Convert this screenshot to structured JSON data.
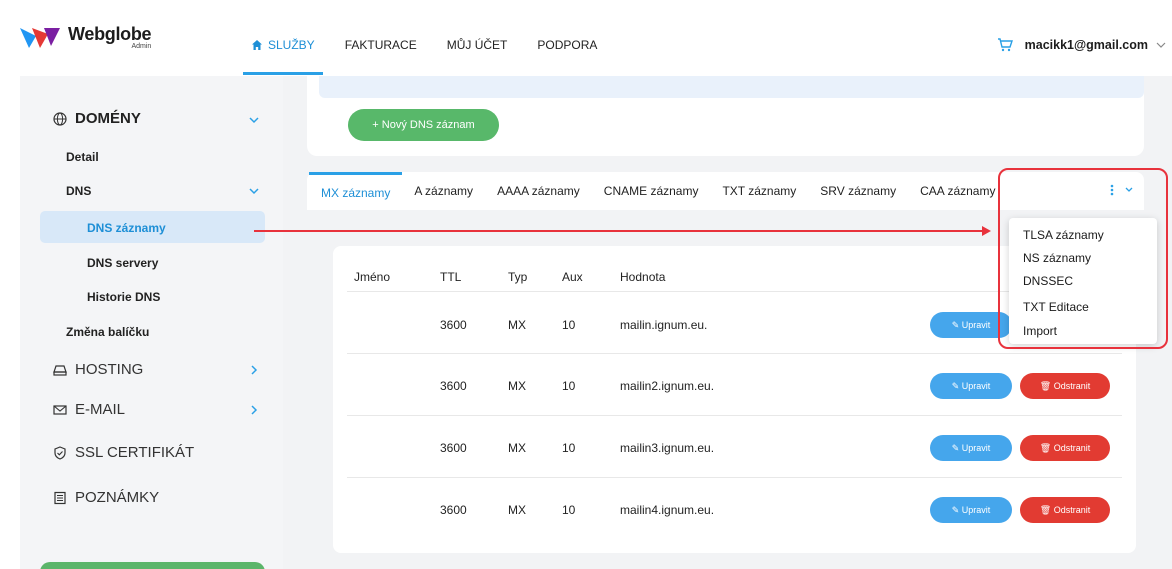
{
  "app": {
    "brand": "Webglobe",
    "brand_sub": "Admin"
  },
  "nav": [
    {
      "label": "SLUŽBY",
      "active": true
    },
    {
      "label": "FAKTURACE"
    },
    {
      "label": "MŮJ ÚČET"
    },
    {
      "label": "PODPORA"
    }
  ],
  "user": {
    "email": "macikk1@gmail.com"
  },
  "sidebar": {
    "domeny": "DOMÉNY",
    "detail": "Detail",
    "dns": "DNS",
    "dns_zaznamy": "DNS záznamy",
    "dns_servery": "DNS servery",
    "historie": "Historie DNS",
    "zmena": "Změna balíčku",
    "hosting": "HOSTING",
    "email": "E-MAIL",
    "ssl": "SSL CERTIFIKÁT",
    "poznamky": "POZNÁMKY"
  },
  "main": {
    "new_button": "+ Nový DNS záznam",
    "tabs": [
      "MX záznamy",
      "A záznamy",
      "AAAA záznamy",
      "CNAME záznamy",
      "TXT záznamy",
      "SRV záznamy",
      "CAA záznamy"
    ],
    "columns": {
      "jmeno": "Jméno",
      "ttl": "TTL",
      "typ": "Typ",
      "aux": "Aux",
      "hodnota": "Hodnota"
    },
    "rows": [
      {
        "ttl": "3600",
        "typ": "MX",
        "aux": "10",
        "hodnota": "mailin.ignum.eu."
      },
      {
        "ttl": "3600",
        "typ": "MX",
        "aux": "10",
        "hodnota": "mailin2.ignum.eu."
      },
      {
        "ttl": "3600",
        "typ": "MX",
        "aux": "10",
        "hodnota": "mailin3.ignum.eu."
      },
      {
        "ttl": "3600",
        "typ": "MX",
        "aux": "10",
        "hodnota": "mailin4.ignum.eu."
      }
    ],
    "edit_label": "Upravit",
    "delete_label": "Odstranit"
  },
  "dropdown": [
    "TLSA záznamy",
    "NS záznamy",
    "DNSSEC",
    "TXT Editace",
    "Import"
  ],
  "colors": {
    "accent": "#1e8fd6",
    "green": "#58b86a",
    "red": "#e23b32",
    "highlight": "#e8323c"
  }
}
